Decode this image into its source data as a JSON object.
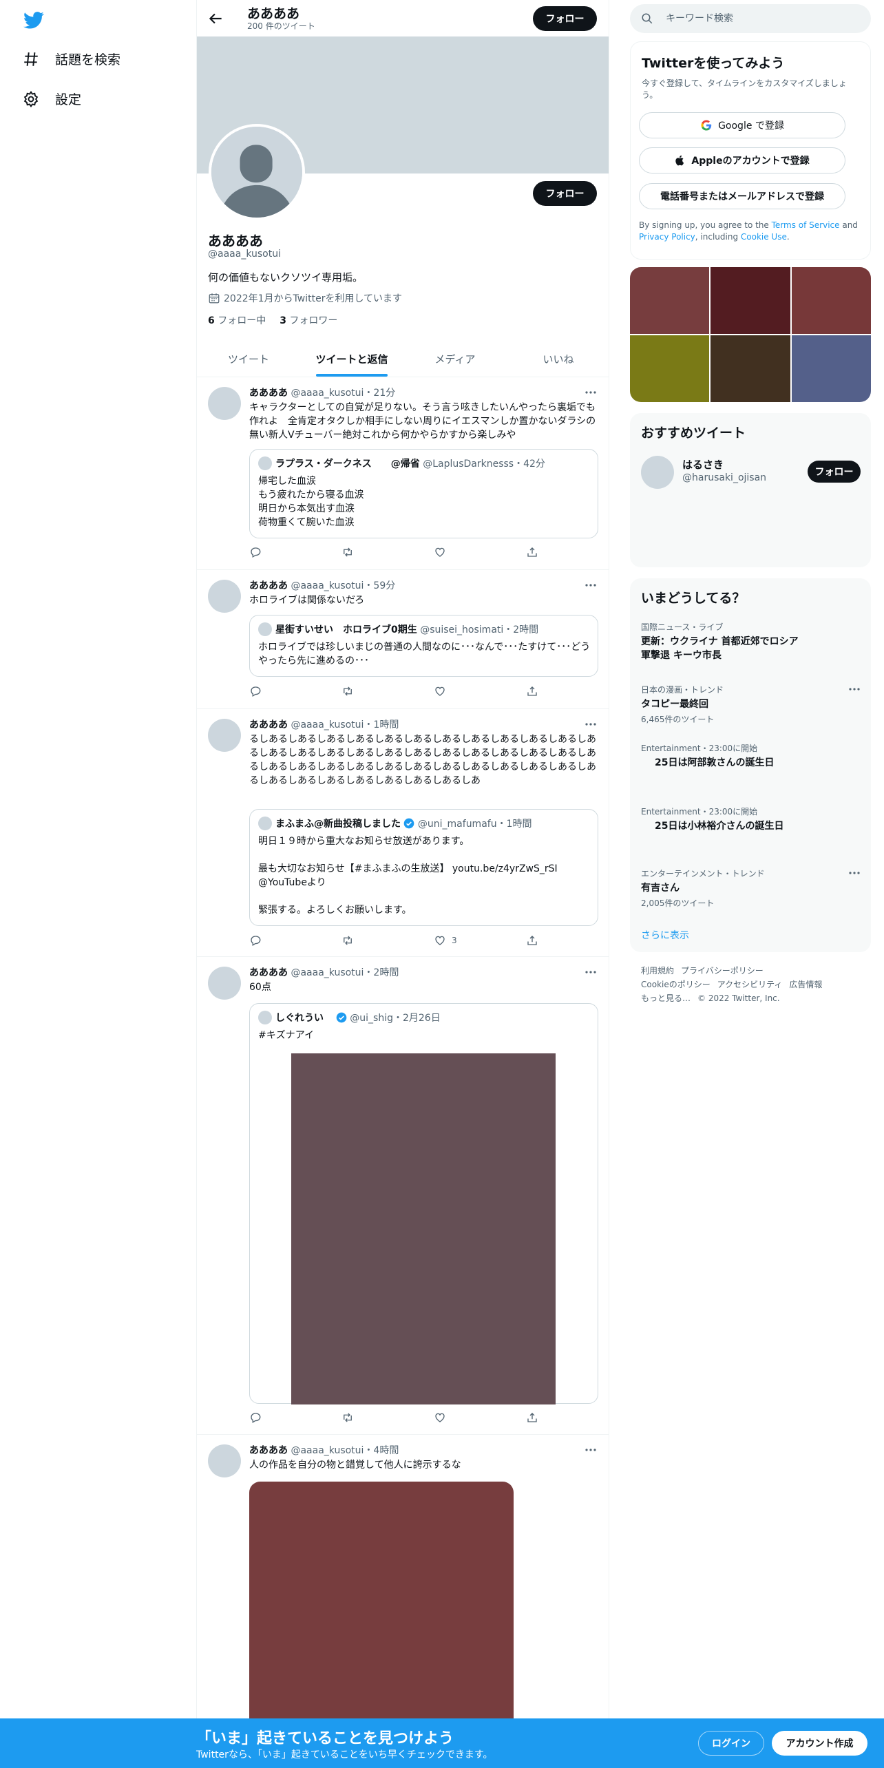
{
  "nav": {
    "items": [
      {
        "label": "話題を検索",
        "icon": "hashtag-icon"
      },
      {
        "label": "設定",
        "icon": "gear-icon"
      }
    ]
  },
  "profile": {
    "top_name": "ああああ",
    "tweet_count": "200 件のツイート",
    "follow_label": "フォロー",
    "name": "ああああ",
    "handle": "@aaaa_kusotui",
    "bio": "何の価値もないクソツイ専用垢。",
    "joined": "2022年1月からTwitterを利用しています",
    "following_num": "6",
    "following_label": "フォロー中",
    "followers_num": "3",
    "followers_label": "フォロワー"
  },
  "tabs": [
    "ツイート",
    "ツイートと返信",
    "メディア",
    "いいね"
  ],
  "tweets": [
    {
      "name": "ああああ",
      "meta": "@aaaa_kusotui・21分",
      "text": "キャラクターとしての自覚が足りない。そう言う呟きしたいんやったら裏垢でも作れよ　全肯定オタクしか相手にしない周りにイエスマンしか置かないダラシの無い新人Vチューバー絶対これから何かやらかすから楽しみや",
      "quote": {
        "name": "ラプラス・ダークネス　　@帰省",
        "meta": "@LaplusDarknesss・42分",
        "text": "帰宅した血涙\nもう疲れたから寝る血涙\n明日から本気出す血涙\n荷物重くて腕いた血涙"
      },
      "likes": ""
    },
    {
      "name": "ああああ",
      "meta": "@aaaa_kusotui・59分",
      "text": "ホロライブは関係ないだろ",
      "quote": {
        "name": "星街すいせい　ホロライブ0期生",
        "meta": "@suisei_hosimati・2時間",
        "text": "ホロライブでは珍しいまじの普通の人間なのに･･･なんで･･･たすけて･･･どうやったら先に進めるの･･･"
      },
      "likes": ""
    },
    {
      "name": "ああああ",
      "meta": "@aaaa_kusotui・1時間",
      "text": "るしあるしあるしあるしあるしあるしあるしあるしあるしあるしあるしあるしあるしあるしあるしあるしあるしあるしあるしあるしあるしあるしあるしあるしあるしあるしあるしあるしあるしあるしあるしあるしあるしあるしあるしあるしあるしあるしあるしあるしあるしあるしあるしあるしあ",
      "quote": {
        "name": "まふまふ@新曲投稿しました",
        "meta": "@uni_mafumafu・1時間",
        "text": "明日１９時から重大なお知らせ放送があります。\n\n最も大切なお知らせ【#まふまふの生放送】 youtu.be/z4yrZwS_rSI\n@YouTubeより\n\n緊張する。よろしくお願いします。"
      },
      "likes": "3"
    },
    {
      "name": "ああああ",
      "meta": "@aaaa_kusotui・2時間",
      "text": "60点",
      "quote": {
        "name": "しぐれうい",
        "meta": "@ui_shig・2月26日",
        "text": "#キズナアイ"
      },
      "likes": ""
    },
    {
      "name": "ああああ",
      "meta": "@aaaa_kusotui・4時間",
      "text": "人の作品を自分の物と錯覚して他人に誇示するな",
      "likes": ""
    }
  ],
  "colors": {
    "accent": "#1d9bf0",
    "quote_image": "#654f55",
    "tweet_image": "#773d3e"
  },
  "search": {
    "placeholder": "キーワード検索"
  },
  "signup": {
    "title": "Twitterを使ってみよう",
    "subtitle": "今すぐ登録して、タイムラインをカスタマイズしましょう。",
    "google": "Google で登録",
    "apple": "Appleのアカウントで登録",
    "phone": "電話番号またはメールアドレスで登録",
    "legal_pre": "By signing up, you agree to the ",
    "terms": "Terms of Service",
    "and": " and ",
    "privacy": "Privacy Policy",
    "including": ", including ",
    "cookie": "Cookie Use",
    "end": "."
  },
  "media_grid": [
    "#773d3e",
    "#531c21",
    "#773839",
    "#7a7a16",
    "#413020",
    "#54608a"
  ],
  "recommend": {
    "title": "おすすめツイート",
    "name": "はるさき",
    "handle": "@harusaki_ojisan",
    "follow": "フォロー"
  },
  "trends": {
    "title": "いまどうしてる？",
    "items": [
      {
        "cat": "国際ニュース・ライブ",
        "name": "更新：ウクライナ 首都近郊でロシア軍撃退 キーウ市長",
        "count": ""
      },
      {
        "cat": "日本の漫画・トレンド",
        "name": "タコピー最終回",
        "count": "6,465件のツイート"
      },
      {
        "cat": "Entertainment・23:00に開始",
        "name": "25日は阿部敦さんの誕生日",
        "count": ""
      },
      {
        "cat": "Entertainment・23:00に開始",
        "name": "25日は小林裕介さんの誕生日",
        "count": ""
      },
      {
        "cat": "エンターテインメント・トレンド",
        "name": "有吉さん",
        "count": "2,005件のツイート"
      }
    ],
    "show_more": "さらに表示"
  },
  "footer": [
    "利用規約",
    "プライバシーポリシー",
    "Cookieのポリシー",
    "アクセシビリティ",
    "広告情報",
    "もっと見る…",
    "© 2022 Twitter, Inc."
  ],
  "bottom": {
    "title": "「いま」起きていることを見つけよう",
    "subtitle": "Twitterなら、「いま」起きていることをいち早くチェックできます。",
    "login": "ログイン",
    "signup": "アカウント作成"
  }
}
